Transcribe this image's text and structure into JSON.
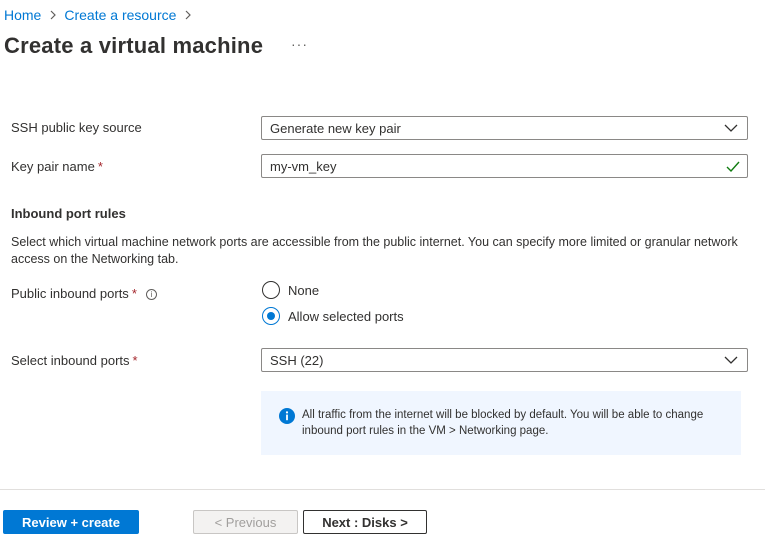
{
  "breadcrumb": {
    "items": [
      "Home",
      "Create a resource"
    ]
  },
  "page": {
    "title": "Create a virtual machine",
    "more_label": "···"
  },
  "ssh_key_source": {
    "label": "SSH public key source",
    "value": "Generate new key pair"
  },
  "key_pair_name": {
    "label": "Key pair name",
    "required_mark": "*",
    "value": "my-vm_key"
  },
  "inbound_rules": {
    "title": "Inbound port rules",
    "description": "Select which virtual machine network ports are accessible from the public internet. You can specify more limited or granular network access on the Networking tab."
  },
  "public_inbound_ports": {
    "label": "Public inbound ports",
    "required_mark": "*",
    "info_glyph": "i",
    "options": [
      {
        "label": "None",
        "selected": false
      },
      {
        "label": "Allow selected ports",
        "selected": true
      }
    ]
  },
  "select_inbound_ports": {
    "label": "Select inbound ports",
    "required_mark": "*",
    "value": "SSH (22)"
  },
  "info_message": {
    "text": "All traffic from the internet will be blocked by default. You will be able to change inbound port rules in the VM > Networking page."
  },
  "footer": {
    "review_label": "Review + create",
    "previous_label": "< Previous",
    "next_label": "Next : Disks >"
  },
  "colors": {
    "accent": "#0078d4",
    "required": "#a4262c",
    "valid_check": "#107c10",
    "info_background": "#f0f6ff"
  },
  "icons": [
    "chevron-right-icon",
    "more-icon",
    "chevron-down-icon",
    "checkmark-icon",
    "info-icon"
  ]
}
